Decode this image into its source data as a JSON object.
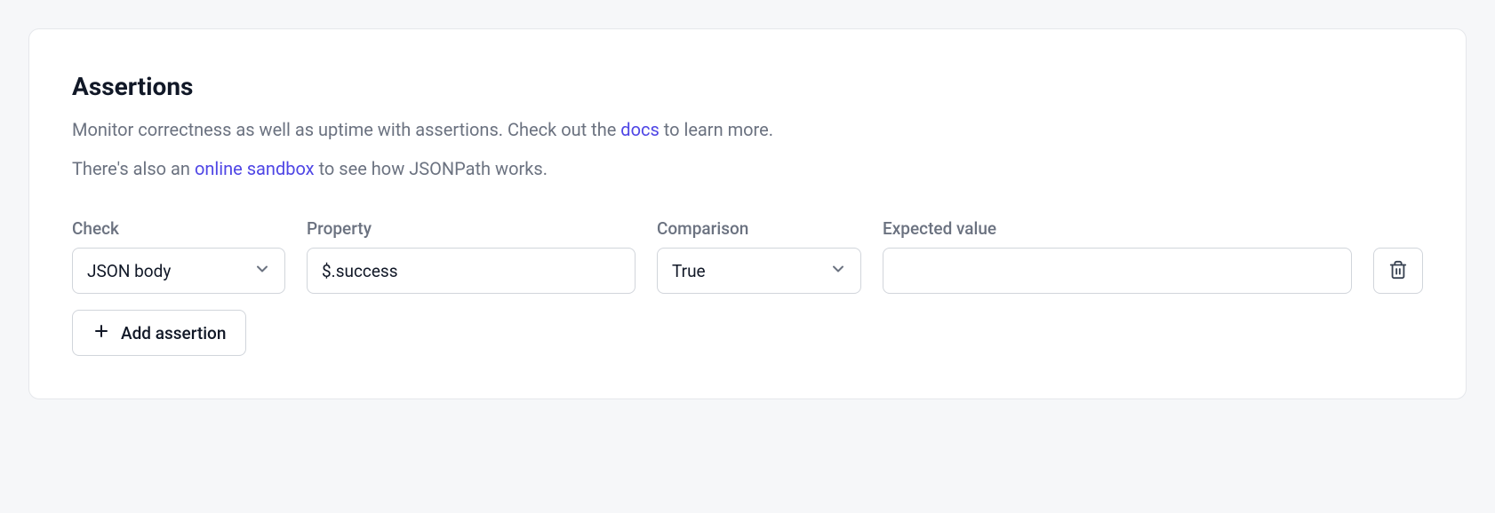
{
  "section": {
    "title": "Assertions",
    "description1_a": "Monitor correctness as well as uptime with assertions. Check out the ",
    "description1_link": "docs",
    "description1_b": " to learn more.",
    "description2_a": "There's also an ",
    "description2_link": "online sandbox",
    "description2_b": " to see how JSONPath works."
  },
  "labels": {
    "check": "Check",
    "property": "Property",
    "comparison": "Comparison",
    "expected": "Expected value"
  },
  "row": {
    "check": "JSON body",
    "property": "$.success",
    "comparison": "True",
    "expected": ""
  },
  "buttons": {
    "add_assertion": "Add assertion"
  }
}
